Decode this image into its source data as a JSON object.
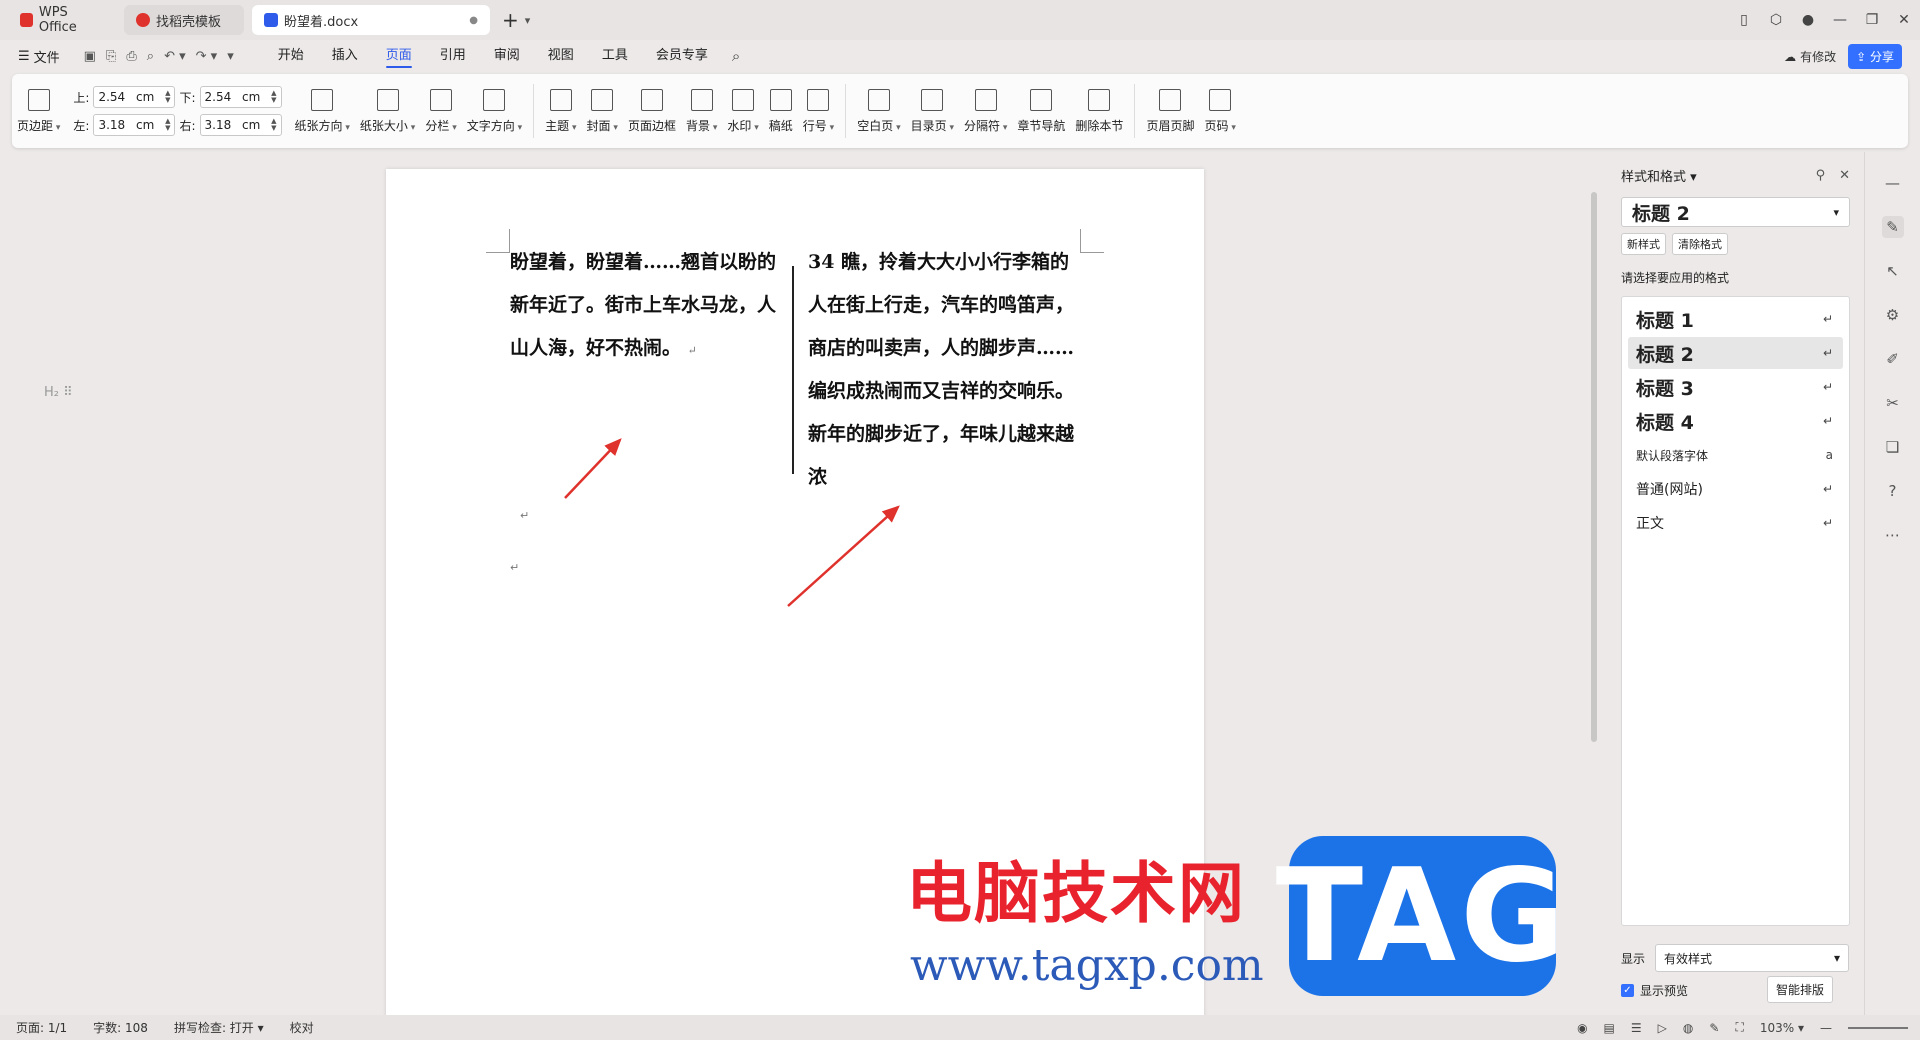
{
  "tabs": [
    {
      "label": "WPS Office",
      "color": "#e0322c"
    },
    {
      "label": "找稻壳模板",
      "color": "#e0322c"
    },
    {
      "label": "盼望着.docx",
      "color": "#2f5bea"
    }
  ],
  "menu": {
    "file": "文件",
    "tabs": [
      "开始",
      "插入",
      "页面",
      "引用",
      "审阅",
      "视图",
      "工具",
      "会员专享"
    ],
    "active_tab": "页面",
    "modified": "有修改",
    "share": "分享"
  },
  "ribbon": {
    "margin": "页边距",
    "top_label": "上:",
    "top_value": "2.54",
    "bottom_label": "下:",
    "bottom_value": "2.54",
    "left_label": "左:",
    "left_value": "3.18",
    "right_label": "右:",
    "right_value": "3.18",
    "unit": "cm",
    "orientation": "纸张方向",
    "size": "纸张大小",
    "columns": "分栏",
    "text_direction": "文字方向",
    "theme": "主题",
    "cover": "封面",
    "page_border": "页面边框",
    "background": "背景",
    "watermark": "水印",
    "manuscript": "稿纸",
    "line_number": "行号",
    "blank_page": "空白页",
    "toc_page": "目录页",
    "separator": "分隔符",
    "section_nav": "章节导航",
    "delete_section": "删除本节",
    "header_footer": "页眉页脚",
    "page_number": "页码"
  },
  "document": {
    "col1_text": "盼望着，盼望着……翘首以盼的新年近了。街市上车水马龙，人山人海，好不热闹。",
    "col2_text": "34 瞧，拎着大大小小行李箱的人在街上行走，汽车的鸣笛声，商店的叫卖声，人的脚步声……编织成热闹而又吉祥的交响乐。新年的脚步近了，年味儿越来越浓",
    "para_mark": "↵",
    "h2_marker": "H₂ ⠿"
  },
  "watermark": {
    "text": "电脑技术网",
    "url": "www.tagxp.com",
    "tag": "TAG"
  },
  "pane": {
    "title": "样式和格式",
    "current_style": "标题 2",
    "new_style": "新样式",
    "clear_format": "清除格式",
    "hint": "请选择要应用的格式",
    "styles": [
      {
        "name": "标题 1",
        "mark": "↵",
        "kind": "h"
      },
      {
        "name": "标题 2",
        "mark": "↵",
        "kind": "h"
      },
      {
        "name": "标题 3",
        "mark": "↵",
        "kind": "h"
      },
      {
        "name": "标题 4",
        "mark": "↵",
        "kind": "h"
      },
      {
        "name": "默认段落字体",
        "mark": "a",
        "kind": "xs"
      },
      {
        "name": "普通(网站)",
        "mark": "↵",
        "kind": "s"
      },
      {
        "name": "正文",
        "mark": "↵",
        "kind": "s"
      }
    ],
    "show_label": "显示",
    "show_value": "有效样式",
    "preview": "显示预览",
    "smart": "智能排版"
  },
  "status": {
    "page": "页面: 1/1",
    "words": "字数: 108",
    "spell": "拼写检查: 打开",
    "proof": "校对",
    "zoom": "103%"
  }
}
